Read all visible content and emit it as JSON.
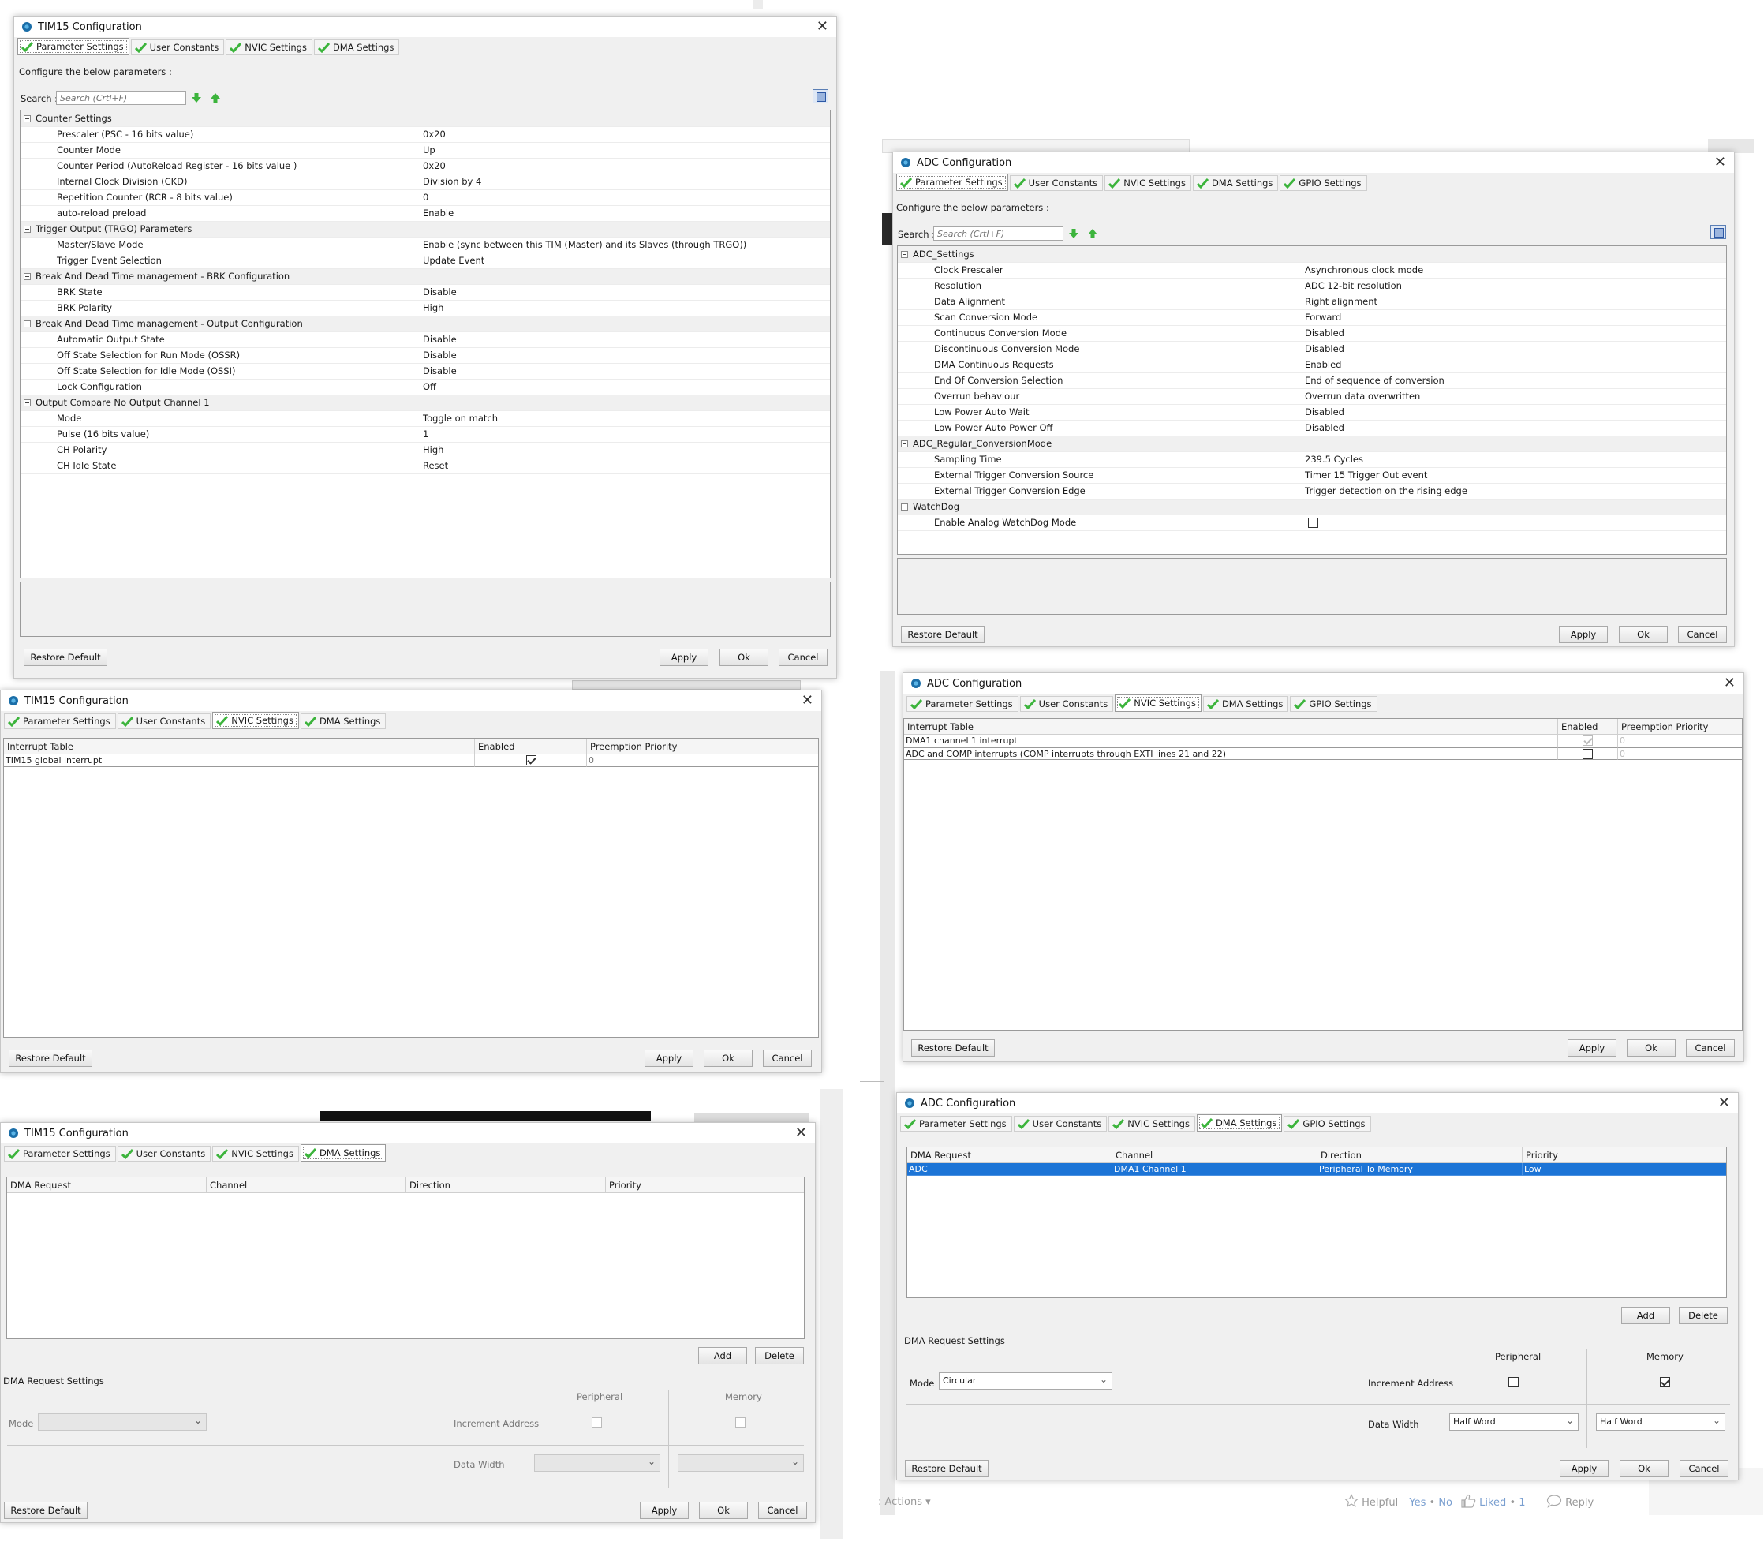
{
  "tabs": {
    "parameter": "Parameter Settings",
    "user_constants": "User Constants",
    "nvic": "NVIC Settings",
    "dma": "DMA Settings",
    "gpio": "GPIO Settings"
  },
  "common": {
    "configure_text": "Configure the below parameters :",
    "search_label": "Search :",
    "search_placeholder": "Search (Crtl+F)",
    "restore_default": "Restore Default",
    "apply": "Apply",
    "ok": "Ok",
    "cancel": "Cancel",
    "add": "Add",
    "delete": "Delete",
    "close_symbol": "✕"
  },
  "tim15_params": {
    "title": "TIM15 Configuration",
    "groups": [
      {
        "name": "Counter Settings",
        "rows": [
          {
            "k": "Prescaler (PSC - 16 bits value)",
            "v": "0x20"
          },
          {
            "k": "Counter Mode",
            "v": "Up"
          },
          {
            "k": "Counter Period (AutoReload Register - 16 bits value )",
            "v": "0x20"
          },
          {
            "k": "Internal Clock Division (CKD)",
            "v": "Division by 4"
          },
          {
            "k": "Repetition Counter (RCR - 8 bits value)",
            "v": "0"
          },
          {
            "k": "auto-reload preload",
            "v": "Enable"
          }
        ]
      },
      {
        "name": "Trigger Output (TRGO) Parameters",
        "rows": [
          {
            "k": "Master/Slave Mode",
            "v": "Enable (sync between this TIM (Master) and its Slaves (through TRGO))"
          },
          {
            "k": "Trigger Event Selection",
            "v": "Update Event"
          }
        ]
      },
      {
        "name": "Break And Dead Time management - BRK Configuration",
        "rows": [
          {
            "k": "BRK State",
            "v": "Disable"
          },
          {
            "k": "BRK Polarity",
            "v": "High"
          }
        ]
      },
      {
        "name": "Break And Dead Time management - Output Configuration",
        "rows": [
          {
            "k": "Automatic Output State",
            "v": "Disable"
          },
          {
            "k": "Off State Selection for Run Mode (OSSR)",
            "v": "Disable"
          },
          {
            "k": "Off State Selection for Idle Mode (OSSI)",
            "v": "Disable"
          },
          {
            "k": "Lock Configuration",
            "v": "Off"
          }
        ]
      },
      {
        "name": "Output Compare No Output Channel 1",
        "rows": [
          {
            "k": "Mode",
            "v": "Toggle on match"
          },
          {
            "k": "Pulse (16 bits value)",
            "v": "1"
          },
          {
            "k": "CH Polarity",
            "v": "High"
          },
          {
            "k": "CH Idle State",
            "v": "Reset"
          }
        ]
      }
    ]
  },
  "adc_params": {
    "title": "ADC Configuration",
    "groups": [
      {
        "name": "ADC_Settings",
        "rows": [
          {
            "k": "Clock Prescaler",
            "v": "Asynchronous clock mode"
          },
          {
            "k": "Resolution",
            "v": "ADC 12-bit resolution"
          },
          {
            "k": "Data Alignment",
            "v": "Right alignment"
          },
          {
            "k": "Scan Conversion Mode",
            "v": "Forward"
          },
          {
            "k": "Continuous Conversion Mode",
            "v": "Disabled"
          },
          {
            "k": "Discontinuous Conversion Mode",
            "v": "Disabled"
          },
          {
            "k": "DMA Continuous Requests",
            "v": "Enabled"
          },
          {
            "k": "End Of Conversion Selection",
            "v": "End of sequence of conversion"
          },
          {
            "k": "Overrun behaviour",
            "v": "Overrun data overwritten"
          },
          {
            "k": "Low Power Auto Wait",
            "v": "Disabled"
          },
          {
            "k": "Low Power Auto Power Off",
            "v": "Disabled"
          }
        ]
      },
      {
        "name": "ADC_Regular_ConversionMode",
        "rows": [
          {
            "k": "Sampling Time",
            "v": "239.5 Cycles"
          },
          {
            "k": "External Trigger Conversion Source",
            "v": "Timer 15 Trigger Out event"
          },
          {
            "k": "External Trigger Conversion Edge",
            "v": "Trigger detection on the rising edge"
          }
        ]
      },
      {
        "name": "WatchDog",
        "rows": [
          {
            "k": "Enable Analog WatchDog Mode",
            "v": "",
            "checkbox": true
          }
        ]
      }
    ]
  },
  "tim15_nvic": {
    "title": "TIM15 Configuration",
    "headers": [
      "Interrupt Table",
      "Enabled",
      "Preemption Priority"
    ],
    "rows": [
      {
        "name": "TIM15 global interrupt",
        "enabled": true,
        "priority": "0"
      }
    ]
  },
  "adc_nvic": {
    "title": "ADC Configuration",
    "headers": [
      "Interrupt Table",
      "Enabled",
      "Preemption Priority"
    ],
    "rows": [
      {
        "name": "DMA1 channel 1 interrupt",
        "enabled": true,
        "priority": "0"
      },
      {
        "name": "ADC and COMP interrupts (COMP interrupts through EXTI lines 21 and 22)",
        "enabled": false,
        "priority": "0"
      }
    ]
  },
  "tim15_dma": {
    "title": "TIM15 Configuration",
    "headers": [
      "DMA Request",
      "Channel",
      "Direction",
      "Priority"
    ],
    "settings_label": "DMA Request Settings",
    "peripheral": "Peripheral",
    "memory": "Memory",
    "mode_label": "Mode",
    "increment_label": "Increment Address",
    "width_label": "Data Width"
  },
  "adc_dma": {
    "title": "ADC Configuration",
    "headers": [
      "DMA Request",
      "Channel",
      "Direction",
      "Priority"
    ],
    "row": {
      "request": "ADC",
      "channel": "DMA1 Channel 1",
      "direction": "Peripheral To Memory",
      "priority": "Low"
    },
    "settings_label": "DMA Request Settings",
    "peripheral": "Peripheral",
    "memory": "Memory",
    "mode_label": "Mode",
    "mode_value": "Circular",
    "increment_label": "Increment Address",
    "width_label": "Data Width",
    "width_peripheral": "Half Word",
    "width_memory": "Half Word"
  },
  "forum": {
    "actions": ": Actions",
    "helpful": "Helpful",
    "yes": "Yes",
    "dot": "•",
    "no": "No",
    "liked": "Liked",
    "liked_count": "1",
    "reply": "Reply"
  },
  "colors": {
    "check_green": "#3cb43c",
    "selection_blue": "#1c74d6",
    "dialog_bg": "#f0f0f0"
  }
}
